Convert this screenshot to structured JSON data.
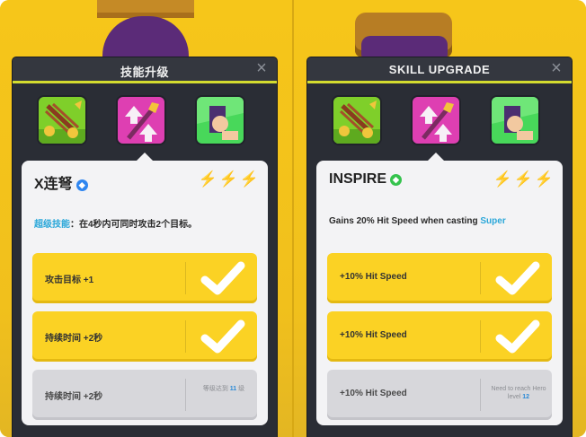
{
  "left_panel": {
    "title": "技能升级",
    "skill_name": "X连弩",
    "level_bolts": [
      "on",
      "on",
      "off"
    ],
    "desc_highlight": "超级技能",
    "desc_rest": "：在4秒内可同时攻击2个目标。",
    "upgrades": [
      {
        "label": "攻击目标 +1",
        "state": "unlocked"
      },
      {
        "label": "持续时间 +2秒",
        "state": "unlocked"
      },
      {
        "label": "持续时间 +2秒",
        "state": "locked",
        "req_text": "等级达到 ",
        "req_level": "11",
        "req_suffix": " 级"
      }
    ]
  },
  "right_panel": {
    "title": "SKILL UPGRADE",
    "skill_name": "INSPIRE",
    "level_bolts": [
      "on",
      "on",
      "off"
    ],
    "desc_text": "Gains 20% Hit Speed when casting ",
    "desc_highlight": "Super",
    "upgrades": [
      {
        "label": "+10% Hit Speed",
        "state": "unlocked"
      },
      {
        "label": "+10% Hit Speed",
        "state": "unlocked"
      },
      {
        "label": "+10% Hit Speed",
        "state": "locked",
        "req_text": "Need to reach Hero level ",
        "req_level": "12"
      }
    ]
  },
  "icons": {
    "close": "close-icon",
    "bolt": "lightning-bolt-icon",
    "check": "check-icon"
  },
  "colors": {
    "accent_line": "#d4dc2f",
    "upgrade_yellow": "#fbd224",
    "locked_grey": "#d7d7db",
    "highlight_blue": "#2aa7d9"
  }
}
